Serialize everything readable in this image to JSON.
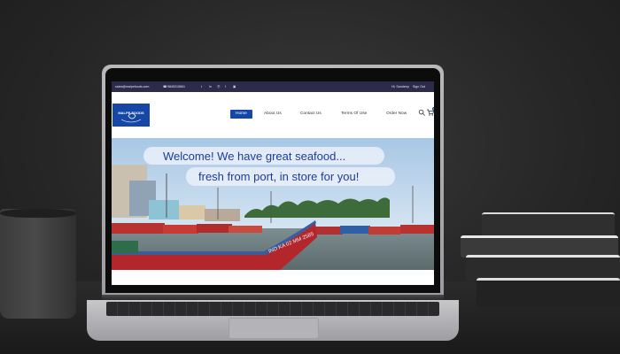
{
  "topbar": {
    "email": "sales@malpefoods.com",
    "phone": "9845315661",
    "greeting": "Hi, Sandeep",
    "sign_out": "Sign Out"
  },
  "logo": {
    "text": "MALPE FOODS"
  },
  "nav": {
    "items": [
      "Home",
      "About Us",
      "Contact Us",
      "Terms Of Use",
      "Order Now"
    ],
    "active": "Home",
    "cart_count": "0"
  },
  "hero": {
    "line1": "Welcome! We have great seafood...",
    "line2": "fresh from port, in store for you!"
  },
  "colors": {
    "brand_blue": "#1747a6",
    "topbar_bg": "#2d2b4a",
    "hero_text": "#1c3c99"
  }
}
